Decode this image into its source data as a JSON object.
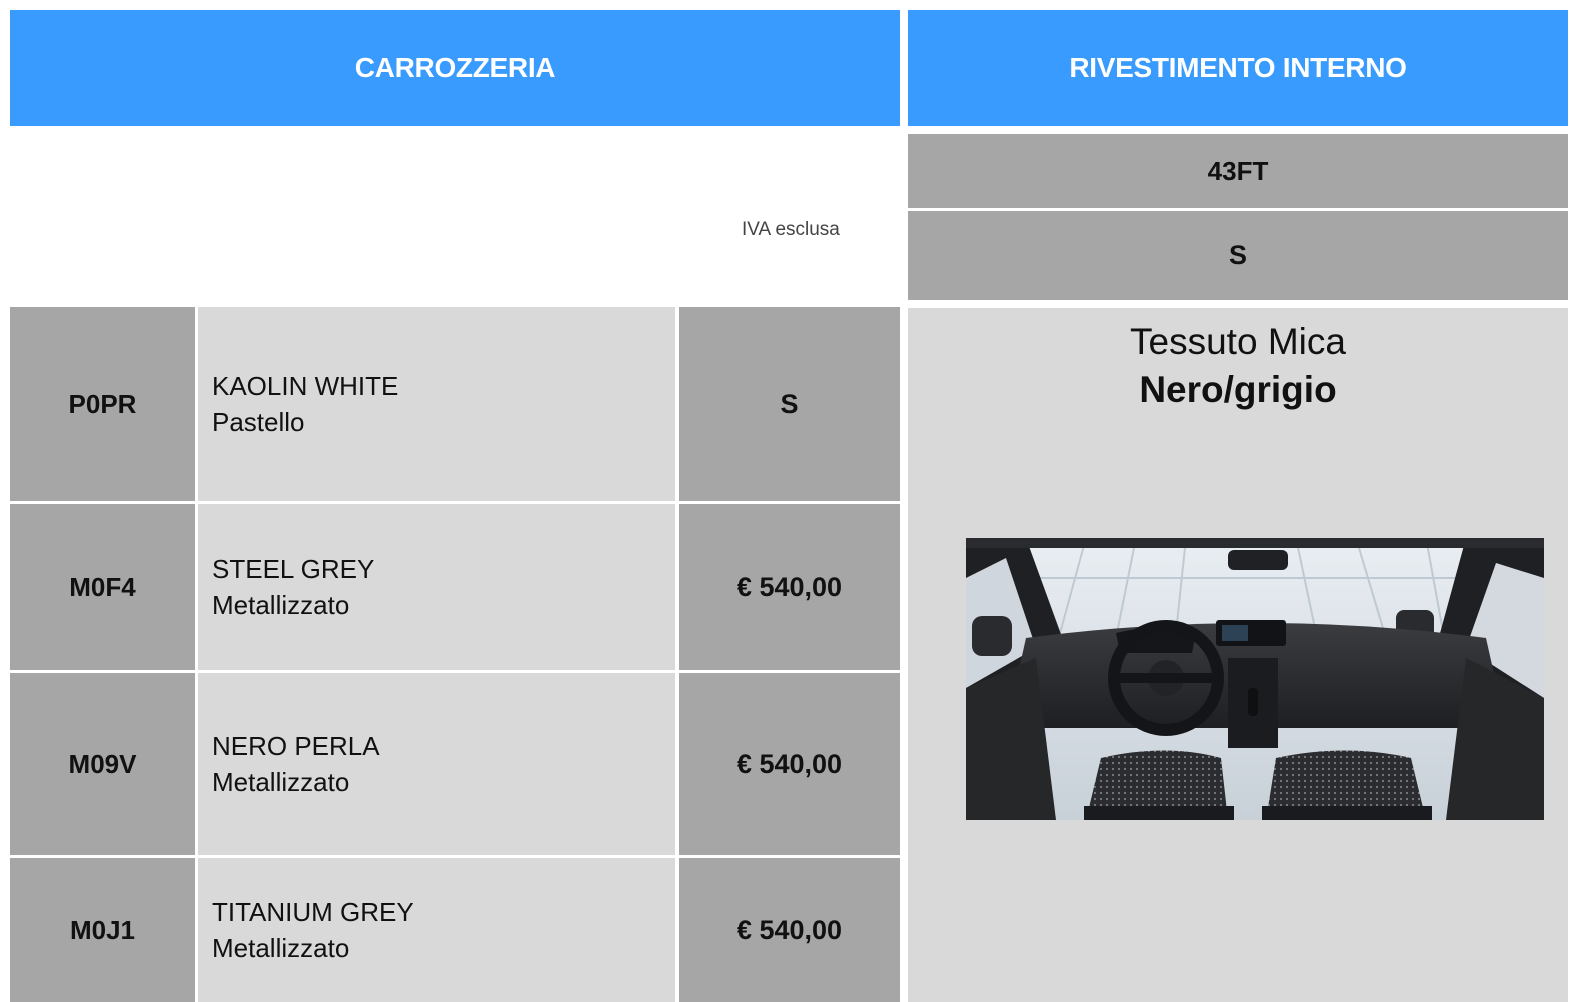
{
  "headers": {
    "body": "CARROZZERIA",
    "interior": "RIVESTIMENTO INTERNO"
  },
  "note": "IVA esclusa",
  "body_colors": [
    {
      "code": "P0PR",
      "name": "KAOLIN WHITE",
      "finish": "Pastello",
      "price": "S"
    },
    {
      "code": "M0F4",
      "name": "STEEL GREY",
      "finish": "Metallizzato",
      "price": "€ 540,00"
    },
    {
      "code": "M09V",
      "name": "NERO PERLA",
      "finish": "Metallizzato",
      "price": "€ 540,00"
    },
    {
      "code": "M0J1",
      "name": "TITANIUM GREY",
      "finish": "Metallizzato",
      "price": "€ 540,00"
    }
  ],
  "interior": {
    "code": "43FT",
    "availability": "S",
    "fabric": "Tessuto Mica",
    "color": "Nero/grigio"
  },
  "colors": {
    "header_blue": "#3a9bff",
    "dark_cell": "#a6a6a6",
    "light_cell": "#d9d9d9"
  }
}
